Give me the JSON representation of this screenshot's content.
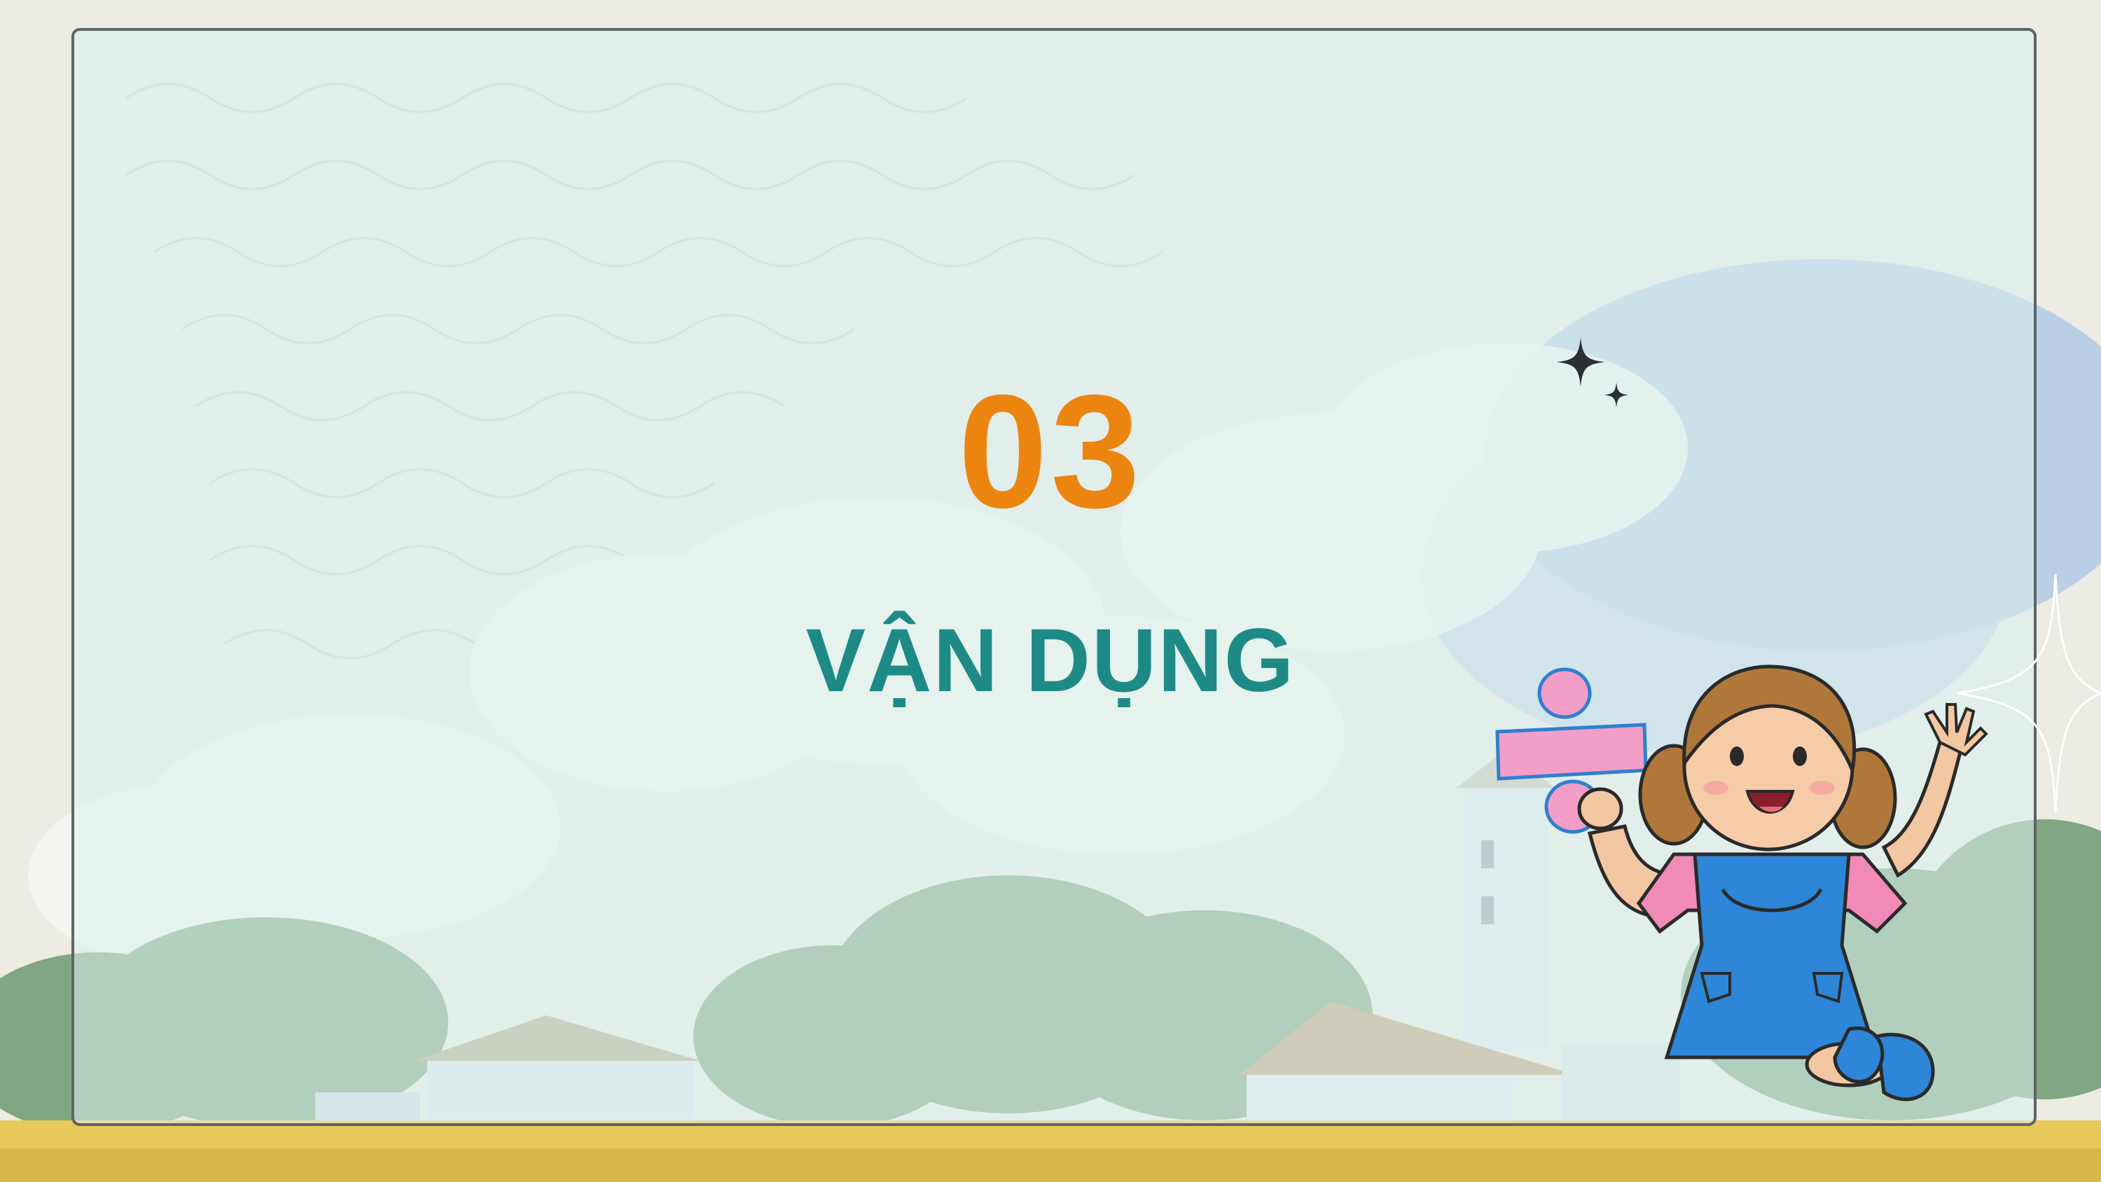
{
  "slide": {
    "section_number": "03",
    "section_title": "VẬN DỤNG"
  },
  "colors": {
    "number": "#ec8410",
    "title": "#1e8a86",
    "frame_border": "#5f6466",
    "panel_tint": "#d8f0ec"
  },
  "icons": [
    "sparkle-icon",
    "sparkle-outline-icon",
    "division-sign-icon",
    "girl-illustration"
  ]
}
